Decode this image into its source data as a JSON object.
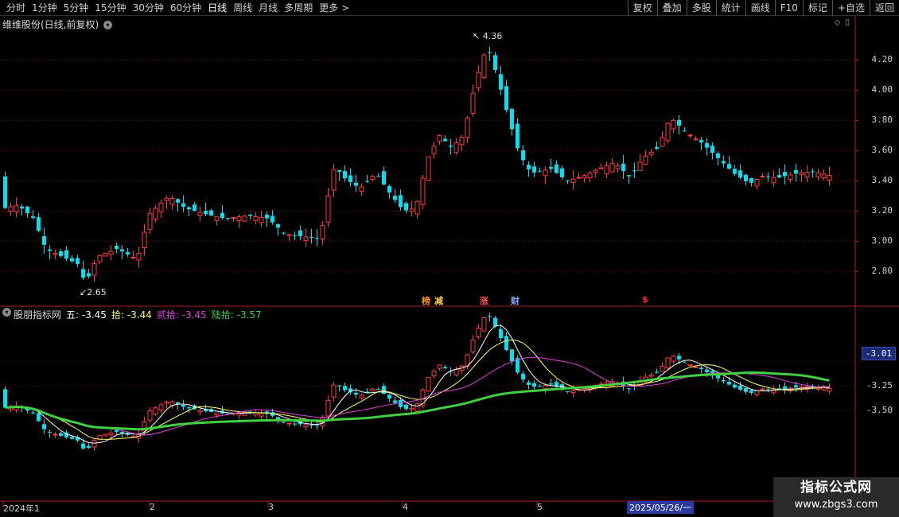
{
  "toolbar": {
    "periods": [
      "分时",
      "1分钟",
      "5分钟",
      "15分钟",
      "30分钟",
      "60分钟",
      "日线",
      "周线",
      "月线",
      "多周期",
      "更多 >"
    ],
    "active_period": "日线",
    "tools": [
      "复权",
      "叠加",
      "多股",
      "统计",
      "画线",
      "F10",
      "标记",
      "+自选",
      "返回"
    ]
  },
  "main_pane": {
    "title": "维维股份(日线,前复权)",
    "price_axis": [
      "4.20",
      "4.00",
      "3.80",
      "3.60",
      "3.40",
      "3.20",
      "3.00",
      "2.80"
    ],
    "high_annotation": "4.36",
    "low_annotation": "2.65",
    "event_tags": [
      {
        "text": "榜",
        "color": "#ff9900"
      },
      {
        "text": "减",
        "color": "#ffd24a"
      },
      {
        "text": "涨",
        "color": "#ff5050"
      },
      {
        "text": "财",
        "color": "#7ab0ff"
      },
      {
        "text": "$",
        "color": "#ff3030"
      }
    ]
  },
  "indicator_pane": {
    "name": "股朋指标网",
    "values": [
      {
        "label": "五:",
        "value": "-3.45",
        "color": "#ffffff"
      },
      {
        "label": "拾:",
        "value": "-3.44",
        "color": "#ffff66"
      },
      {
        "label": "贰拾:",
        "value": "-3.45",
        "color": "#e040e0"
      },
      {
        "label": "陆拾:",
        "value": "-3.57",
        "color": "#40d040"
      }
    ],
    "axis": [
      "-3.25",
      "-3.50"
    ],
    "current_value": "-3.01"
  },
  "time_axis": {
    "months": [
      "2024年1",
      "2",
      "3",
      "4",
      "5"
    ],
    "cursor_date": "2025/05/26/一"
  },
  "watermark": {
    "title": "指标公式网",
    "url": "www.zbgs3.com"
  },
  "colors": {
    "up": "#ff3b3b",
    "down": "#00e0f0",
    "ma5": "#ffffff",
    "ma10": "#ffff66",
    "ma20": "#e040e0",
    "ma60": "#40d040"
  }
}
